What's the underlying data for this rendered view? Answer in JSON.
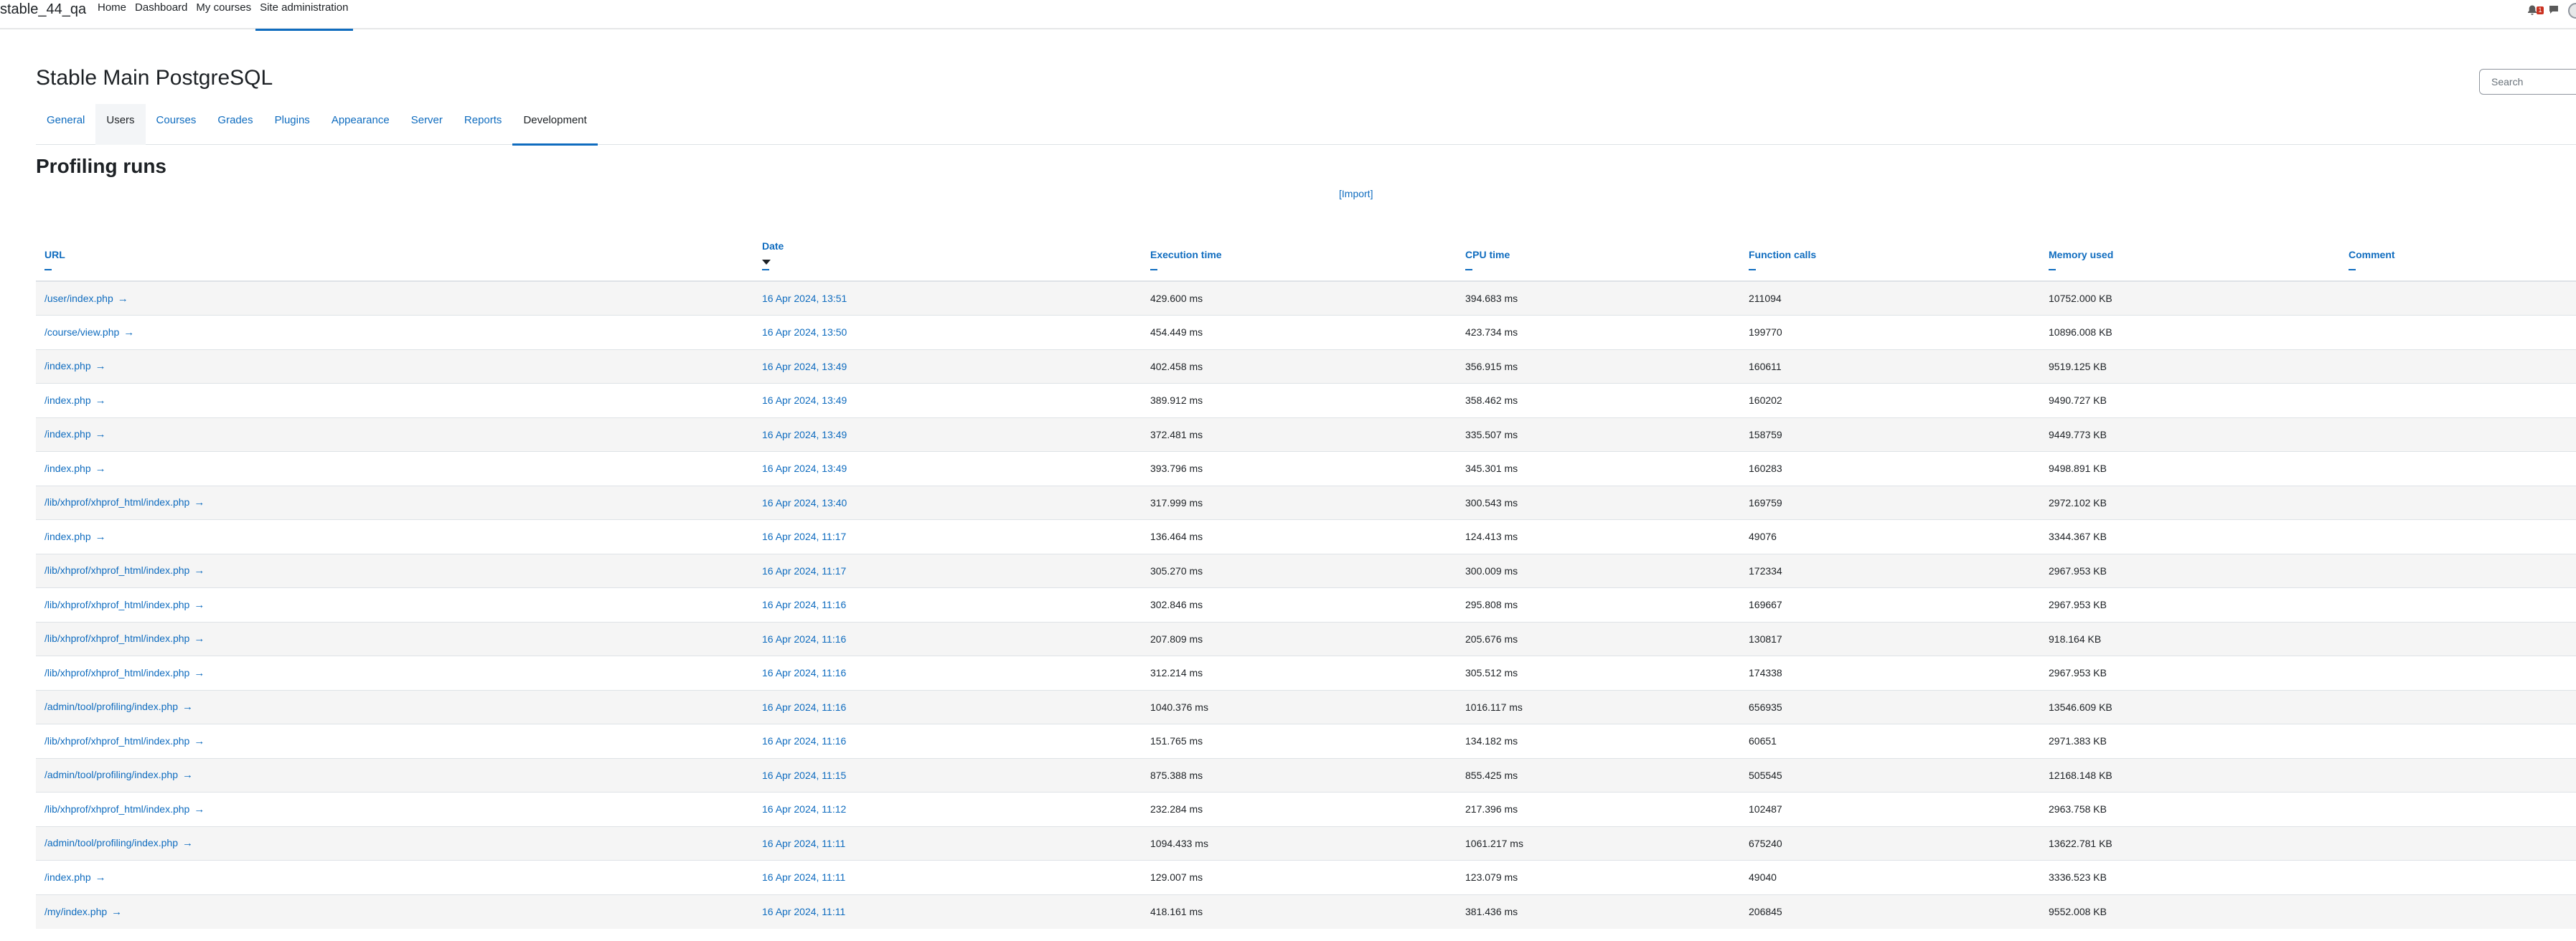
{
  "navbar": {
    "brand": "stable_44_qa",
    "items": [
      {
        "label": "Home"
      },
      {
        "label": "Dashboard"
      },
      {
        "label": "My courses"
      },
      {
        "label": "Site administration",
        "active": true
      }
    ],
    "notification_count": "1"
  },
  "page": {
    "title": "Stable Main PostgreSQL",
    "search_placeholder": "Search"
  },
  "secondary_nav": [
    {
      "label": "General"
    },
    {
      "label": "Users"
    },
    {
      "label": "Courses"
    },
    {
      "label": "Grades"
    },
    {
      "label": "Plugins"
    },
    {
      "label": "Appearance"
    },
    {
      "label": "Server"
    },
    {
      "label": "Reports"
    },
    {
      "label": "Development",
      "active": true
    }
  ],
  "section": {
    "heading": "Profiling runs",
    "import_link": "[Import]"
  },
  "table": {
    "headers": {
      "url": "URL",
      "date": "Date",
      "exec": "Execution time",
      "cpu": "CPU time",
      "calls": "Function calls",
      "mem": "Memory used",
      "comment": "Comment"
    },
    "sorted_by": "Date",
    "sort_direction": "descending",
    "rows": [
      {
        "url": "/user/index.php",
        "date": "16 Apr 2024, 13:51",
        "exec": "429.600 ms",
        "cpu": "394.683 ms",
        "calls": "211094",
        "mem": "10752.000 KB",
        "comment": ""
      },
      {
        "url": "/course/view.php",
        "date": "16 Apr 2024, 13:50",
        "exec": "454.449 ms",
        "cpu": "423.734 ms",
        "calls": "199770",
        "mem": "10896.008 KB",
        "comment": ""
      },
      {
        "url": "/index.php",
        "date": "16 Apr 2024, 13:49",
        "exec": "402.458 ms",
        "cpu": "356.915 ms",
        "calls": "160611",
        "mem": "9519.125 KB",
        "comment": ""
      },
      {
        "url": "/index.php",
        "date": "16 Apr 2024, 13:49",
        "exec": "389.912 ms",
        "cpu": "358.462 ms",
        "calls": "160202",
        "mem": "9490.727 KB",
        "comment": ""
      },
      {
        "url": "/index.php",
        "date": "16 Apr 2024, 13:49",
        "exec": "372.481 ms",
        "cpu": "335.507 ms",
        "calls": "158759",
        "mem": "9449.773 KB",
        "comment": ""
      },
      {
        "url": "/index.php",
        "date": "16 Apr 2024, 13:49",
        "exec": "393.796 ms",
        "cpu": "345.301 ms",
        "calls": "160283",
        "mem": "9498.891 KB",
        "comment": ""
      },
      {
        "url": "/lib/xhprof/xhprof_html/index.php",
        "date": "16 Apr 2024, 13:40",
        "exec": "317.999 ms",
        "cpu": "300.543 ms",
        "calls": "169759",
        "mem": "2972.102 KB",
        "comment": ""
      },
      {
        "url": "/index.php",
        "date": "16 Apr 2024, 11:17",
        "exec": "136.464 ms",
        "cpu": "124.413 ms",
        "calls": "49076",
        "mem": "3344.367 KB",
        "comment": ""
      },
      {
        "url": "/lib/xhprof/xhprof_html/index.php",
        "date": "16 Apr 2024, 11:17",
        "exec": "305.270 ms",
        "cpu": "300.009 ms",
        "calls": "172334",
        "mem": "2967.953 KB",
        "comment": ""
      },
      {
        "url": "/lib/xhprof/xhprof_html/index.php",
        "date": "16 Apr 2024, 11:16",
        "exec": "302.846 ms",
        "cpu": "295.808 ms",
        "calls": "169667",
        "mem": "2967.953 KB",
        "comment": ""
      },
      {
        "url": "/lib/xhprof/xhprof_html/index.php",
        "date": "16 Apr 2024, 11:16",
        "exec": "207.809 ms",
        "cpu": "205.676 ms",
        "calls": "130817",
        "mem": "918.164 KB",
        "comment": ""
      },
      {
        "url": "/lib/xhprof/xhprof_html/index.php",
        "date": "16 Apr 2024, 11:16",
        "exec": "312.214 ms",
        "cpu": "305.512 ms",
        "calls": "174338",
        "mem": "2967.953 KB",
        "comment": ""
      },
      {
        "url": "/admin/tool/profiling/index.php",
        "date": "16 Apr 2024, 11:16",
        "exec": "1040.376 ms",
        "cpu": "1016.117 ms",
        "calls": "656935",
        "mem": "13546.609 KB",
        "comment": ""
      },
      {
        "url": "/lib/xhprof/xhprof_html/index.php",
        "date": "16 Apr 2024, 11:16",
        "exec": "151.765 ms",
        "cpu": "134.182 ms",
        "calls": "60651",
        "mem": "2971.383 KB",
        "comment": ""
      },
      {
        "url": "/admin/tool/profiling/index.php",
        "date": "16 Apr 2024, 11:15",
        "exec": "875.388 ms",
        "cpu": "855.425 ms",
        "calls": "505545",
        "mem": "12168.148 KB",
        "comment": ""
      },
      {
        "url": "/lib/xhprof/xhprof_html/index.php",
        "date": "16 Apr 2024, 11:12",
        "exec": "232.284 ms",
        "cpu": "217.396 ms",
        "calls": "102487",
        "mem": "2963.758 KB",
        "comment": ""
      },
      {
        "url": "/admin/tool/profiling/index.php",
        "date": "16 Apr 2024, 11:11",
        "exec": "1094.433 ms",
        "cpu": "1061.217 ms",
        "calls": "675240",
        "mem": "13622.781 KB",
        "comment": ""
      },
      {
        "url": "/index.php",
        "date": "16 Apr 2024, 11:11",
        "exec": "129.007 ms",
        "cpu": "123.079 ms",
        "calls": "49040",
        "mem": "3336.523 KB",
        "comment": ""
      },
      {
        "url": "/my/index.php",
        "date": "16 Apr 2024, 11:11",
        "exec": "418.161 ms",
        "cpu": "381.436 ms",
        "calls": "206845",
        "mem": "9552.008 KB",
        "comment": ""
      }
    ]
  },
  "colors": {
    "link": "#0f6cbf",
    "text": "#1d2125",
    "row_stripe": "#f5f5f5",
    "notification_badge": "#ca3120"
  },
  "icons": {
    "row_link": "arrow-right-icon",
    "notifications": "bell-icon",
    "messages": "chat-icon",
    "sort": "caret-down-icon"
  }
}
